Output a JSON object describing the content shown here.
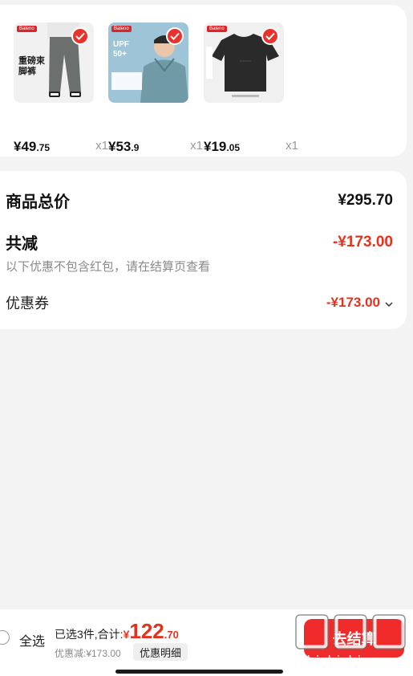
{
  "products": [
    {
      "id": "pants",
      "brand": "Baleno",
      "badge_text": "重磅束脚裤",
      "price_int": "¥49",
      "price_dec": ".75",
      "qty": "x1"
    },
    {
      "id": "jacket",
      "brand": "Baleno",
      "badge_text": "UPF 50+",
      "price_int": "¥53",
      "price_dec": ".9",
      "qty": "x1"
    },
    {
      "id": "tshirt",
      "brand": "Baleno",
      "badge_text": "",
      "price_int": "¥19",
      "price_dec": ".05",
      "qty": "x1"
    }
  ],
  "summary": {
    "total_label": "商品总价",
    "total_value": "¥295.70",
    "reduce_label": "共减",
    "reduce_value": "-¥173.00",
    "note": "以下优惠不包含红包，请在结算页查看",
    "coupon_label": "优惠券",
    "coupon_value": "-¥173.00"
  },
  "bottom_bar": {
    "select_all": "全选",
    "selected_text": "已选3件,合计:",
    "currency": "¥",
    "total_int": "122",
    "total_dec": ".70",
    "discount_text": "优惠减:¥173.00",
    "detail_button": "优惠明细",
    "checkout_button": "去结算"
  },
  "watermark": {
    "text": "zhizhizhi.com"
  },
  "colors": {
    "accent_red": "#e3331f",
    "button_red": "#ef2b2b",
    "background": "#f3f3f3"
  }
}
